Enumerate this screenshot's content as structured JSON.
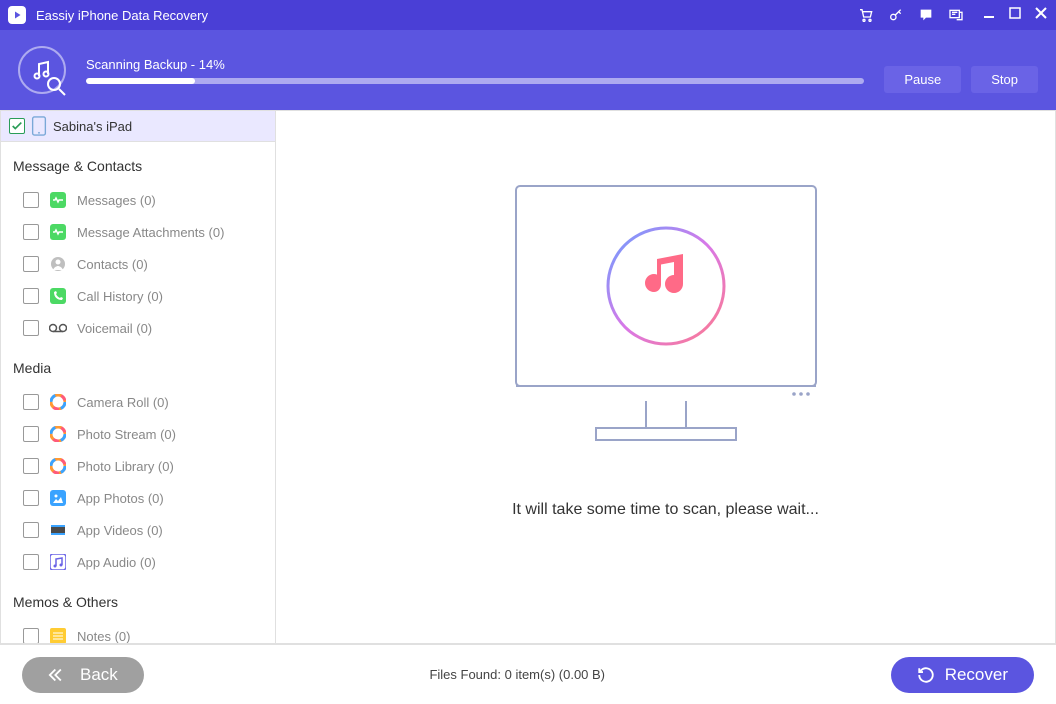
{
  "app": {
    "title": "Eassiy iPhone Data Recovery"
  },
  "progress": {
    "label": "Scanning Backup - 14%",
    "percent": 14,
    "pause": "Pause",
    "stop": "Stop"
  },
  "device": {
    "name": "Sabina's iPad",
    "checked": true
  },
  "groups": [
    {
      "title": "Message & Contacts",
      "items": [
        {
          "id": "messages",
          "label": "Messages (0)",
          "color": "#4cd964"
        },
        {
          "id": "msg-attach",
          "label": "Message Attachments (0)",
          "color": "#4cd964"
        },
        {
          "id": "contacts",
          "label": "Contacts (0)",
          "color": "#bfbfbf"
        },
        {
          "id": "call-history",
          "label": "Call History (0)",
          "color": "#4cd964"
        },
        {
          "id": "voicemail",
          "label": "Voicemail (0)",
          "color": "#ffffff"
        }
      ]
    },
    {
      "title": "Media",
      "items": [
        {
          "id": "camera-roll",
          "label": "Camera Roll (0)",
          "color": "multi"
        },
        {
          "id": "photo-stream",
          "label": "Photo Stream (0)",
          "color": "multi"
        },
        {
          "id": "photo-library",
          "label": "Photo Library (0)",
          "color": "multi"
        },
        {
          "id": "app-photos",
          "label": "App Photos (0)",
          "color": "#3aa3ff"
        },
        {
          "id": "app-videos",
          "label": "App Videos (0)",
          "color": "film"
        },
        {
          "id": "app-audio",
          "label": "App Audio (0)",
          "color": "#6a63e6"
        }
      ]
    },
    {
      "title": "Memos & Others",
      "items": [
        {
          "id": "notes",
          "label": "Notes (0)",
          "color": "#ffcc33"
        }
      ]
    }
  ],
  "main": {
    "waitText": "It will take some time to scan, please wait..."
  },
  "footer": {
    "back": "Back",
    "status": "Files Found: 0 item(s) (0.00 B)",
    "recover": "Recover"
  }
}
